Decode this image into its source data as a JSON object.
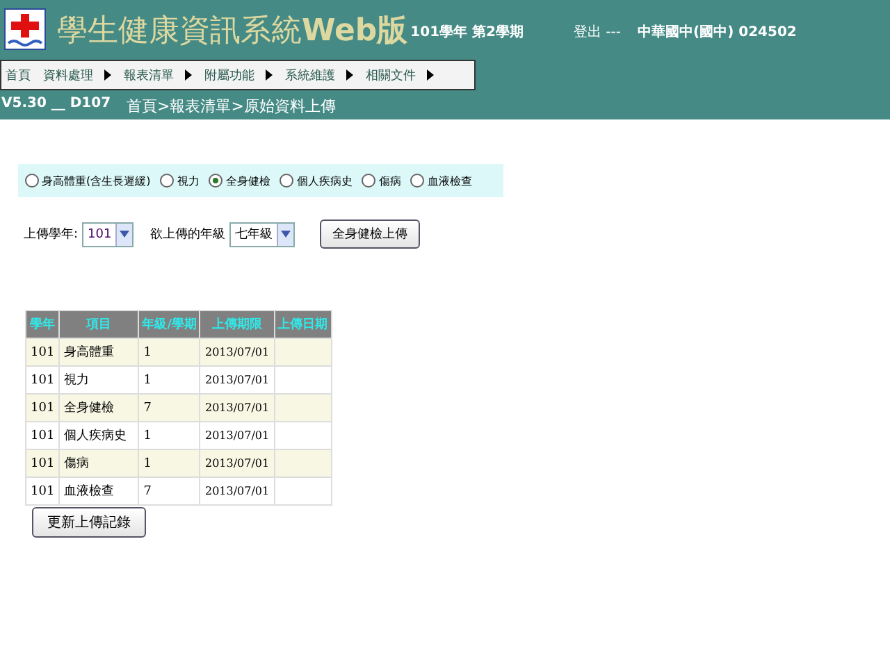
{
  "header": {
    "title": "學生健康資訊系統",
    "title_suffix": "Web版",
    "term": "101學年 第2學期",
    "logout": "登出 ---",
    "school": "中華國中(國中) 024502"
  },
  "menu": [
    {
      "label": "首頁",
      "has_submenu": false
    },
    {
      "label": "資料處理",
      "has_submenu": true
    },
    {
      "label": "報表清單",
      "has_submenu": true
    },
    {
      "label": "附屬功能",
      "has_submenu": true
    },
    {
      "label": "系統維護",
      "has_submenu": true
    },
    {
      "label": "相關文件",
      "has_submenu": true
    }
  ],
  "version": "V5.30 __ D107",
  "breadcrumb": "首頁>報表清單>原始資料上傳",
  "upload_types": [
    {
      "label": "身高體重(含生長遲緩)",
      "selected": false
    },
    {
      "label": "視力",
      "selected": false
    },
    {
      "label": "全身健檢",
      "selected": true
    },
    {
      "label": "個人疾病史",
      "selected": false
    },
    {
      "label": "傷病",
      "selected": false
    },
    {
      "label": "血液檢查",
      "selected": false
    }
  ],
  "year_label": "上傳學年:",
  "year_value": "101",
  "grade_label": "欲上傳的年級",
  "grade_value": "七年級",
  "upload_button": "全身健檢上傳",
  "table": {
    "columns": [
      "學年",
      "項目",
      "年級/學期",
      "上傳期限",
      "上傳日期"
    ],
    "rows": [
      [
        "101",
        "身高體重",
        "1",
        "2013/07/01",
        ""
      ],
      [
        "101",
        "視力",
        "1",
        "2013/07/01",
        ""
      ],
      [
        "101",
        "全身健檢",
        "7",
        "2013/07/01",
        ""
      ],
      [
        "101",
        "個人疾病史",
        "1",
        "2013/07/01",
        ""
      ],
      [
        "101",
        "傷病",
        "1",
        "2013/07/01",
        ""
      ],
      [
        "101",
        "血液檢查",
        "7",
        "2013/07/01",
        ""
      ]
    ]
  },
  "refresh_button": "更新上傳記錄"
}
